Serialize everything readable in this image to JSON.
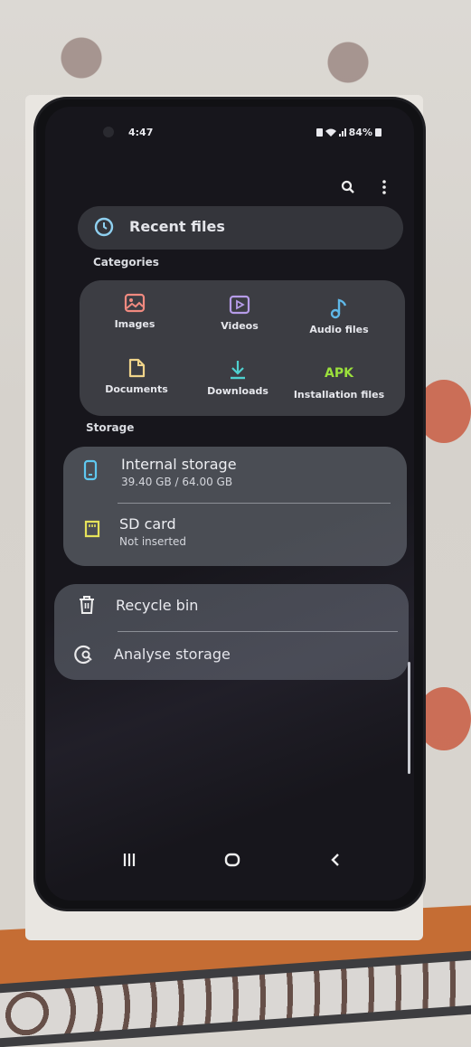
{
  "status_bar": {
    "time": "4:47",
    "battery": "84%"
  },
  "toolbar": {
    "search_icon": "search-icon",
    "more_icon": "more-vertical-icon"
  },
  "recent": {
    "label": "Recent files",
    "icon": "clock-icon"
  },
  "categories": {
    "heading": "Categories",
    "items": [
      {
        "label": "Images",
        "icon": "image-icon",
        "color": "#f08a80"
      },
      {
        "label": "Videos",
        "icon": "video-icon",
        "color": "#b69ce8"
      },
      {
        "label": "Audio files",
        "icon": "music-note-icon",
        "color": "#5fb8e8"
      },
      {
        "label": "Documents",
        "icon": "document-icon",
        "color": "#f0d48a"
      },
      {
        "label": "Downloads",
        "icon": "download-icon",
        "color": "#4fd2d0"
      },
      {
        "label": "Installation files",
        "icon": "apk-icon",
        "icon_text": "APK",
        "color": "#9be03c"
      }
    ]
  },
  "storage": {
    "heading": "Storage",
    "internal": {
      "title": "Internal storage",
      "subtitle": "39.40 GB / 64.00 GB",
      "used_gb": 39.4,
      "total_gb": 64.0,
      "color": "#5fc8f0"
    },
    "sd": {
      "title": "SD card",
      "subtitle": "Not inserted",
      "color": "#e6e35a"
    }
  },
  "tools": {
    "recycle": {
      "title": "Recycle bin"
    },
    "analyse": {
      "title": "Analyse storage"
    }
  },
  "navbar": {
    "recents": "recents-icon",
    "home": "home-icon",
    "back": "back-icon"
  }
}
